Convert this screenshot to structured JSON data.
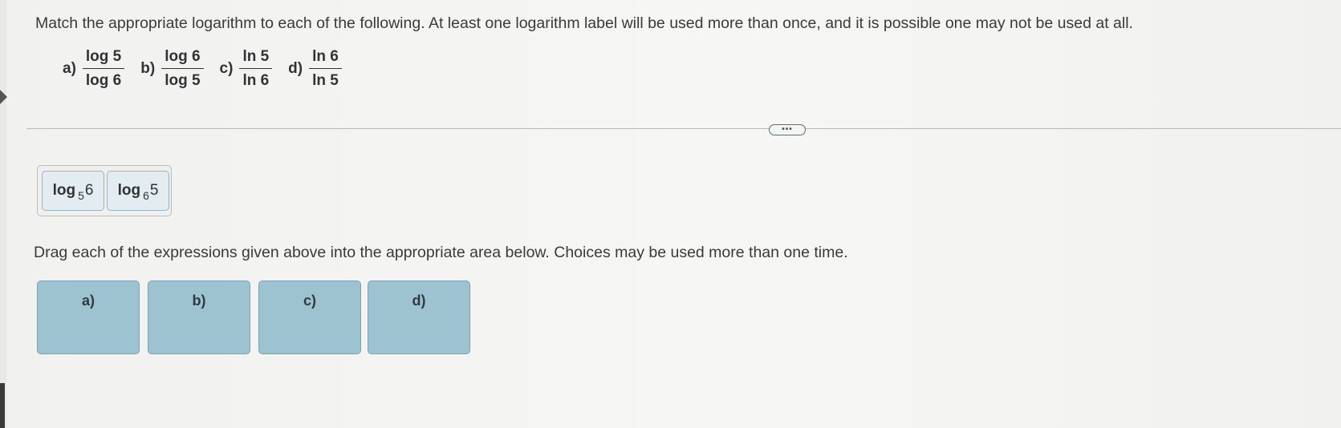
{
  "question": "Match the appropriate logarithm to each of the following. At least one logarithm label will be used more than once, and it is possible one may not be used at all.",
  "fractions": [
    {
      "label": "a)",
      "numerator": "log 5",
      "denominator": "log 6"
    },
    {
      "label": "b)",
      "numerator": "log 6",
      "denominator": "log 5"
    },
    {
      "label": "c)",
      "numerator": "ln 5",
      "denominator": "ln 6"
    },
    {
      "label": "d)",
      "numerator": "ln 6",
      "denominator": "ln 5"
    }
  ],
  "more_button": "•••",
  "choices": [
    {
      "func": "log",
      "base": "5",
      "arg": "6"
    },
    {
      "func": "log",
      "base": "6",
      "arg": "5"
    }
  ],
  "instruction": "Drag each of the expressions given above into the appropriate area below. Choices may be used more than one time.",
  "drop_zones": [
    {
      "label": "a)"
    },
    {
      "label": "b)"
    },
    {
      "label": "c)"
    },
    {
      "label": "d)"
    }
  ]
}
